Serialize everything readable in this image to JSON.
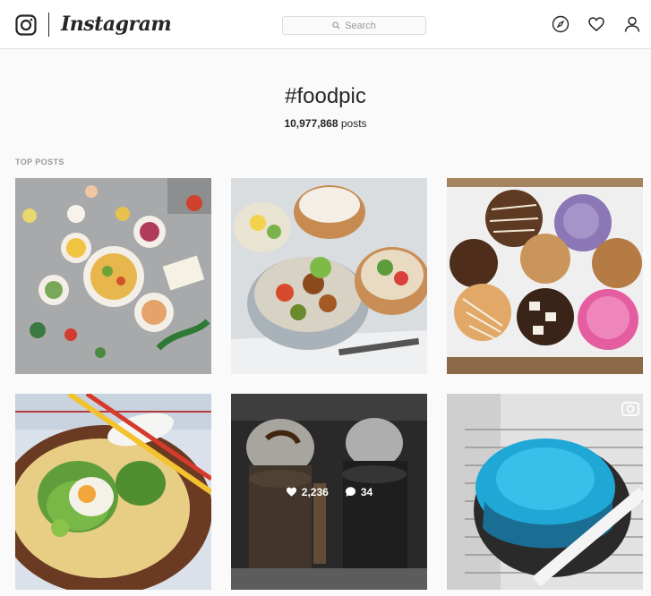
{
  "header": {
    "brand": "Instagram",
    "search_placeholder": "Search",
    "icons": [
      "camera-logo-icon",
      "compass-icon",
      "heart-icon",
      "user-icon"
    ]
  },
  "hashtag": {
    "title": "#foodpic",
    "post_count": "10,977,868",
    "post_suffix": " posts"
  },
  "section": {
    "label": "TOP POSTS"
  },
  "posts": [
    {
      "subject": "flat lay of salads and fruit"
    },
    {
      "subject": "bento lunch boxes"
    },
    {
      "subject": "tray of assorted cookies"
    },
    {
      "subject": "ramen bowl with chopsticks"
    },
    {
      "subject": "freakshake milkshakes",
      "likes": "2,236",
      "comments": "34"
    },
    {
      "subject": "blue glazed cake on rack",
      "media": "video"
    }
  ],
  "colors": {
    "accent_text": "#262626",
    "border": "#dbdbdb",
    "muted": "#999999"
  }
}
